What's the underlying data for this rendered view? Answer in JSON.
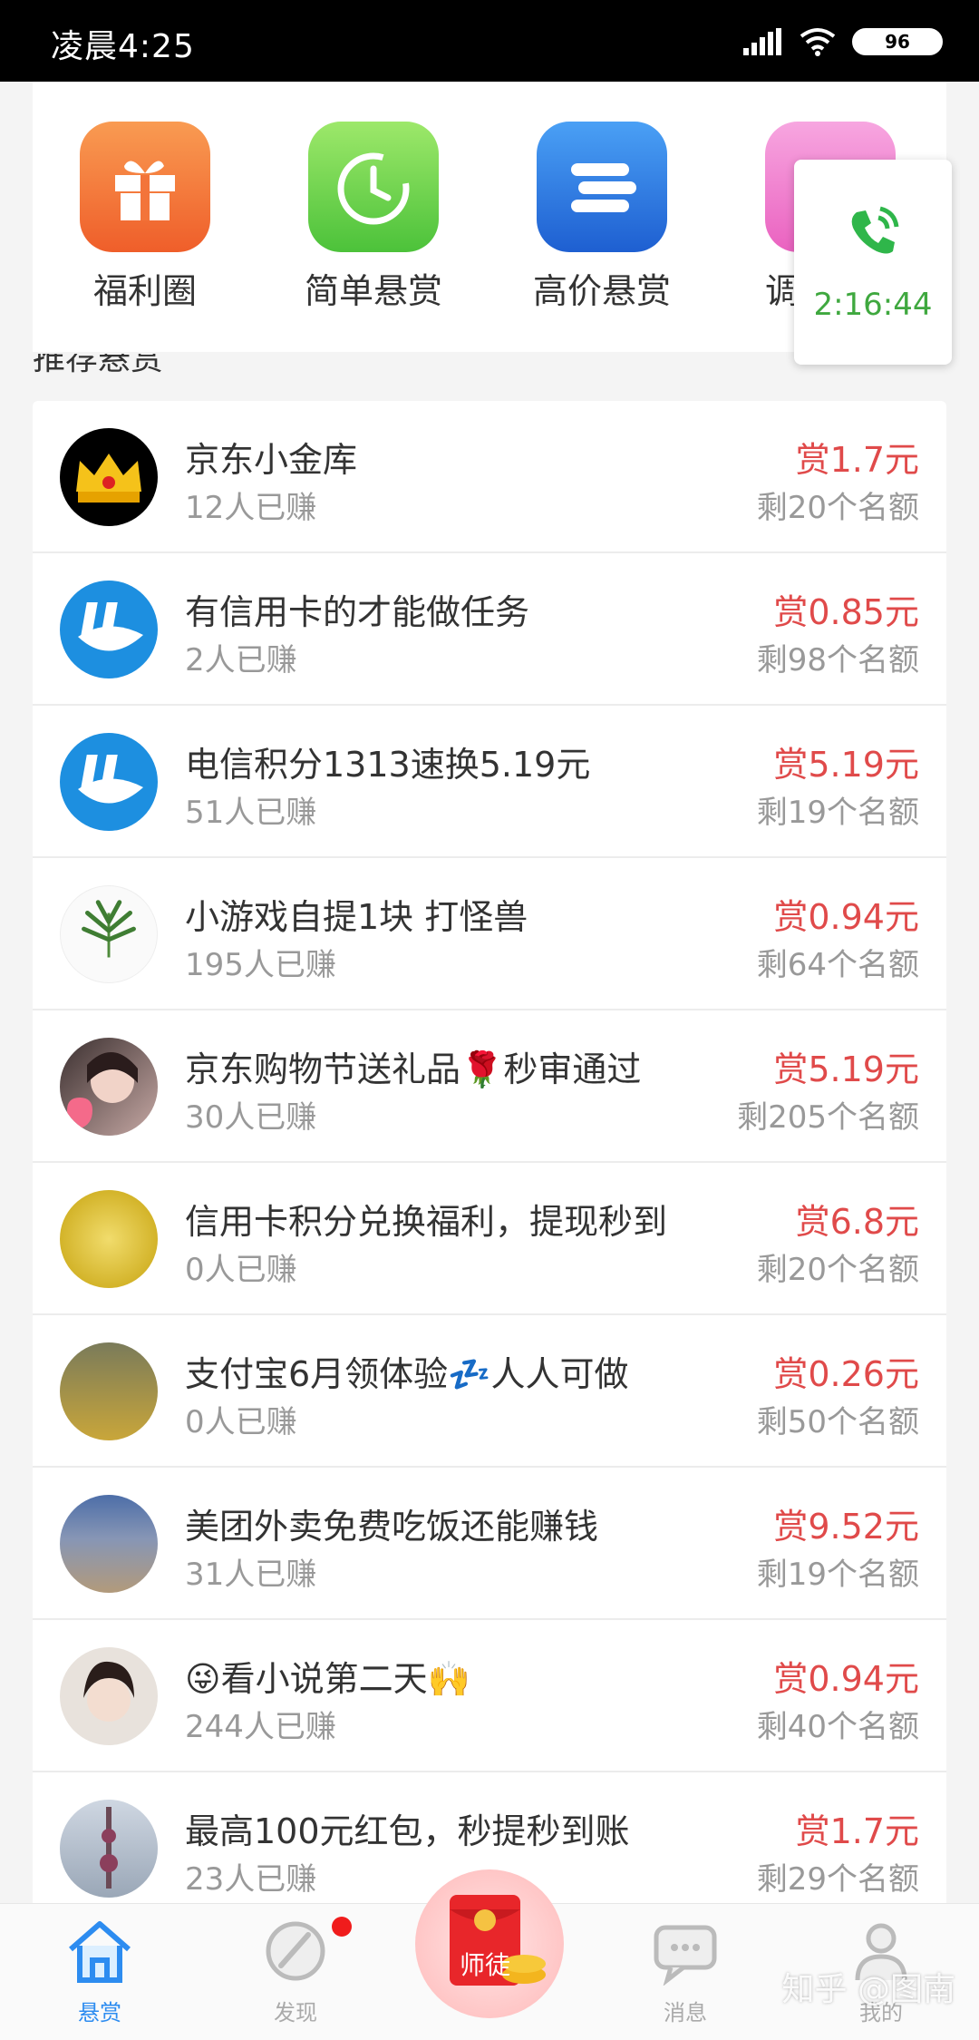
{
  "status_bar": {
    "time": "凌晨4:25",
    "battery": "96"
  },
  "categories": [
    {
      "label": "福利圈",
      "icon": "gift-icon",
      "color": "#f3743a"
    },
    {
      "label": "简单悬赏",
      "icon": "clock-icon",
      "color": "#6dd24a"
    },
    {
      "label": "高价悬赏",
      "icon": "stack-icon",
      "color": "#2f7ae0"
    },
    {
      "label": "调",
      "icon": "pink-icon",
      "color": "#f07ac8"
    }
  ],
  "section_title": "推荐悬赏",
  "call_float": {
    "time": "2:16:44",
    "icon": "phone-call-icon"
  },
  "tasks": [
    {
      "title": "京东小金库",
      "earned": "12人已赚",
      "reward": "赏1.7元",
      "quota": "剩20个名额",
      "avatar": "crown-avatar"
    },
    {
      "title": "有信用卡的才能做任务",
      "earned": "2人已赚",
      "reward": "赏0.85元",
      "quota": "剩98个名额",
      "avatar": "bang-avatar"
    },
    {
      "title": "电信积分1313速换5.19元",
      "earned": "51人已赚",
      "reward": "赏5.19元",
      "quota": "剩19个名额",
      "avatar": "bang-avatar"
    },
    {
      "title": "小游戏自提1块 打怪兽",
      "earned": "195人已赚",
      "reward": "赏0.94元",
      "quota": "剩64个名额",
      "avatar": "leaf-avatar"
    },
    {
      "title": "京东购物节送礼品🌹秒审通过",
      "earned": "30人已赚",
      "reward": "赏5.19元",
      "quota": "剩205个名额",
      "avatar": "girl-avatar"
    },
    {
      "title": "信用卡积分兑换福利，提现秒到",
      "earned": "0人已赚",
      "reward": "赏6.8元",
      "quota": "剩20个名额",
      "avatar": "gold-avatar"
    },
    {
      "title": "支付宝6月领体验💤人人可做",
      "earned": "0人已赚",
      "reward": "赏0.26元",
      "quota": "剩50个名额",
      "avatar": "group-avatar"
    },
    {
      "title": "美团外卖免费吃饭还能赚钱",
      "earned": "31人已赚",
      "reward": "赏9.52元",
      "quota": "剩19个名额",
      "avatar": "city-avatar"
    },
    {
      "title": "😜看小说第二天🙌",
      "earned": "244人已赚",
      "reward": "赏0.94元",
      "quota": "剩40个名额",
      "avatar": "woman-avatar"
    },
    {
      "title": "最高100元红包，秒提秒到账",
      "earned": "23人已赚",
      "reward": "赏1.7元",
      "quota": "剩29个名额",
      "avatar": "tower-avatar"
    }
  ],
  "tabs": [
    {
      "label": "悬赏",
      "icon": "home-icon",
      "active": true
    },
    {
      "label": "发现",
      "icon": "palette-icon"
    },
    {
      "label": "师徒",
      "icon": "red-envelope-icon"
    },
    {
      "label": "消息",
      "icon": "message-icon"
    },
    {
      "label": "我的",
      "icon": "user-icon"
    }
  ],
  "watermark": "知乎 @图南"
}
